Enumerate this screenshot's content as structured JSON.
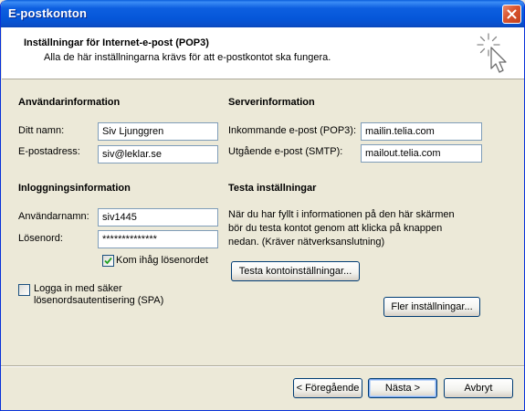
{
  "window": {
    "title": "E-postkonton"
  },
  "header": {
    "title": "Inställningar för Internet-e-post (POP3)",
    "subtitle": "Alla de här inställningarna krävs för att e-postkontot ska fungera."
  },
  "user_info": {
    "heading": "Användarinformation",
    "name_label": "Ditt namn:",
    "name_value": "Siv Ljunggren",
    "email_label": "E-postadress:",
    "email_value": "siv@leklar.se"
  },
  "server_info": {
    "heading": "Serverinformation",
    "incoming_label": "Inkommande e-post (POP3):",
    "incoming_value": "mailin.telia.com",
    "outgoing_label": "Utgående e-post (SMTP):",
    "outgoing_value": "mailout.telia.com"
  },
  "login_info": {
    "heading": "Inloggningsinformation",
    "username_label": "Användarnamn:",
    "username_value": "siv1445",
    "password_label": "Lösenord:",
    "password_value": "**************",
    "remember_label": "Kom ihåg lösenordet",
    "remember_checked": true,
    "spa_label_line1": "Logga in med säker",
    "spa_label_line2": "lösenordsautentisering (SPA)",
    "spa_checked": false
  },
  "test_settings": {
    "heading": "Testa inställningar",
    "description_line1": "När du har fyllt i informationen på den här skärmen",
    "description_line2": "bör du testa kontot genom att klicka på knappen",
    "description_line3": "nedan. (Kräver nätverksanslutning)",
    "test_button": "Testa kontoinställningar...",
    "more_button": "Fler inställningar..."
  },
  "footer": {
    "back_button": "< Föregående",
    "next_button": "Nästa >",
    "cancel_button": "Avbryt"
  },
  "icons": {
    "close": "close-icon",
    "wizard": "wizard-cursor-icon",
    "checkmark": "checkmark-icon"
  },
  "colors": {
    "titlebar": "#0556d8",
    "dialog_bg": "#ece9d8",
    "close_button": "#d9532d",
    "field_border": "#7f9db9"
  }
}
